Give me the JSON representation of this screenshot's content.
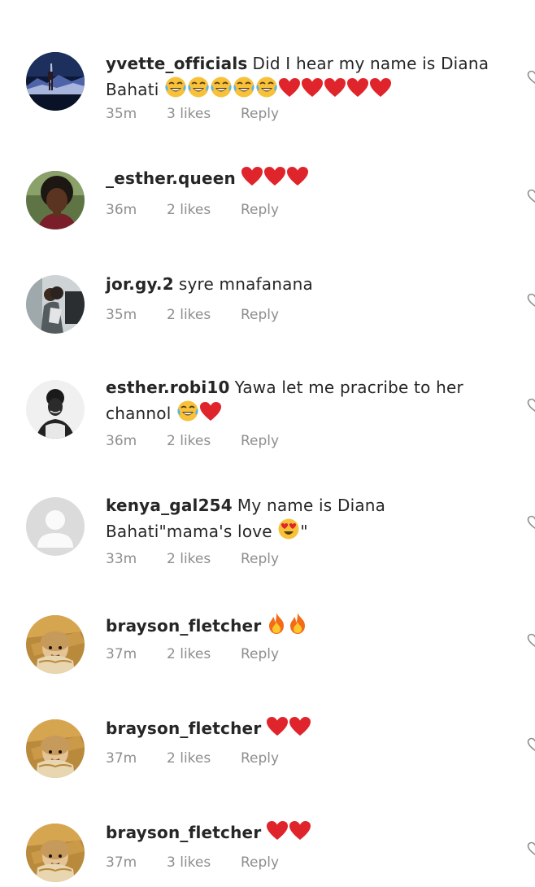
{
  "colors": {
    "username": "#262626",
    "meta": "#8e8e8e",
    "heart": "#e0242c",
    "background": "#ffffff"
  },
  "top_fragment": "·",
  "comments": [
    {
      "username": "yvette_officials",
      "text": "Did I hear my name is Diana Bahati",
      "emojis": [
        "joy",
        "joy",
        "joy",
        "joy",
        "joy",
        "heart",
        "heart",
        "heart",
        "heart",
        "heart"
      ],
      "time": "35m",
      "likes": "3 likes",
      "reply": "Reply",
      "avatar": "landscape-photo-avatar"
    },
    {
      "username": "_esther.queen",
      "text": "",
      "emojis": [
        "heart",
        "heart",
        "heart"
      ],
      "time": "36m",
      "likes": "2 likes",
      "reply": "Reply",
      "avatar": "woman-portrait-avatar"
    },
    {
      "username": "jor.gy.2",
      "text": "syre mnafanana",
      "emojis": [],
      "time": "35m",
      "likes": "2 likes",
      "reply": "Reply",
      "avatar": "couple-photo-avatar"
    },
    {
      "username": "esther.robi10",
      "text": "Yawa let me pracribe to her channol",
      "emojis": [
        "joy",
        "heart"
      ],
      "time": "36m",
      "likes": "2 likes",
      "reply": "Reply",
      "avatar": "bw-portrait-avatar"
    },
    {
      "username": "kenya_gal254",
      "text": "My name is Diana Bahati\"mama's love",
      "emojis": [
        "heart-eyes"
      ],
      "trailing": "\"",
      "time": "33m",
      "likes": "2 likes",
      "reply": "Reply",
      "avatar": "default-avatar"
    },
    {
      "username": "brayson_fletcher",
      "text": "",
      "emojis": [
        "fire",
        "fire"
      ],
      "time": "37m",
      "likes": "2 likes",
      "reply": "Reply",
      "avatar": "baby-photo-avatar"
    },
    {
      "username": "brayson_fletcher",
      "text": "",
      "emojis": [
        "heart",
        "heart"
      ],
      "time": "37m",
      "likes": "2 likes",
      "reply": "Reply",
      "avatar": "baby-photo-avatar"
    },
    {
      "username": "brayson_fletcher",
      "text": "",
      "emojis": [
        "heart",
        "heart"
      ],
      "time": "37m",
      "likes": "3 likes",
      "reply": "Reply",
      "avatar": "baby-photo-avatar"
    }
  ]
}
